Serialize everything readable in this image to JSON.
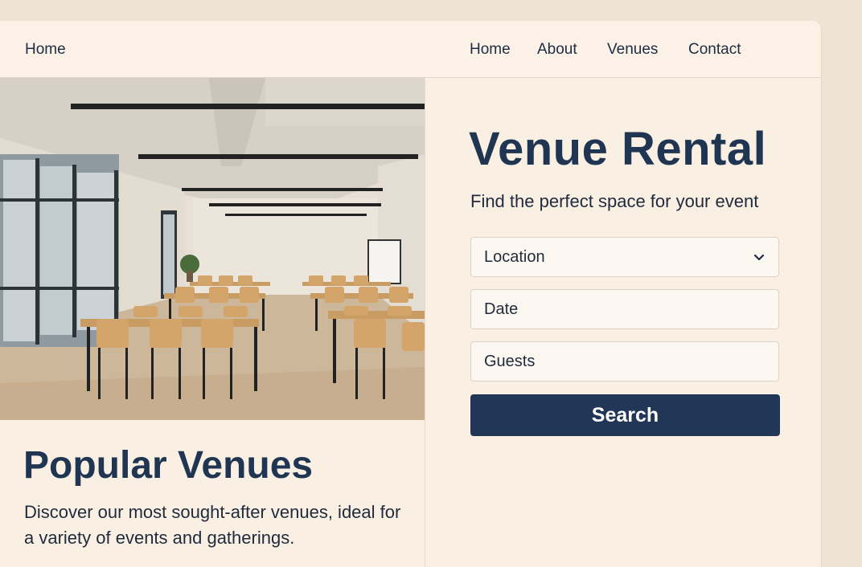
{
  "nav": {
    "brand": "Home",
    "links": [
      "Home",
      "About",
      "Venues",
      "Contact"
    ]
  },
  "hero": {
    "title": "Venue Rental",
    "subtitle": "Find the perfect space for your event"
  },
  "search_form": {
    "location_placeholder": "Location",
    "date_placeholder": "Date",
    "guests_placeholder": "Guests",
    "submit_label": "Search"
  },
  "popular": {
    "title": "Popular Venues",
    "description": "Discover our most sought-after venues, ideal for a variety of events and gatherings."
  },
  "icons": {
    "location_dropdown": "chevron-down-icon"
  },
  "colors": {
    "accent": "#223757",
    "page_background": "#faefe3",
    "text": "#1f2b3d"
  }
}
